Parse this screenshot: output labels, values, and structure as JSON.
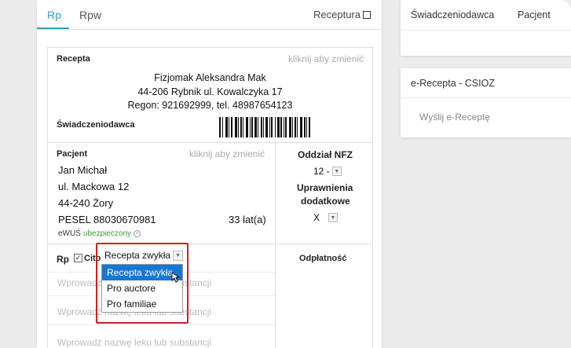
{
  "tabs": {
    "rp": "Rp",
    "rpw": "Rpw",
    "receptura": "Receptura"
  },
  "recepta": {
    "section_label": "Recepta",
    "change_hint": "kliknij aby zmienić",
    "provider_name": "Fizjomak Aleksandra Mak",
    "provider_address": "44-206 Rybnik ul. Kowalczyka 17",
    "provider_regon": "Regon: 921692999, tel. 48987654123",
    "provider_label": "Świadczeniodawca"
  },
  "patient": {
    "section_label": "Pacjent",
    "change_hint": "kliknij aby zmienić",
    "name": "Jan Michał",
    "street": "ul. Mackowa 12",
    "city": "44-240 Żory",
    "pesel": "PESEL  88030670981",
    "age": "33 lat(a)",
    "ewus_label": "eWUŚ",
    "ewus_status": "ubezpieczony"
  },
  "nfz": {
    "label": "Oddział NFZ",
    "value": "12 -",
    "entitlements_label_1": "Uprawnienia",
    "entitlements_label_2": "dodatkowe",
    "entitlements_value": "X"
  },
  "rp_row": {
    "label": "Rp",
    "cito_label": "Cito",
    "select_value": "Recepta zwykła",
    "payment_label": "Odpłatność",
    "placeholder": "Wprowadź nazwę leku lub substancji"
  },
  "dropdown": {
    "options": [
      "Recepta zwykła",
      "Pro auctore",
      "Pro familiae"
    ]
  },
  "right_panel": {
    "tab1": "Świadczeniodawca",
    "tab2": "Pacjent",
    "ecard_title": "e-Recepta - CSIOZ",
    "send_link": "Wyślij e-Receptę"
  },
  "colors": {
    "accent": "#2aa4c4",
    "selected": "#1877d2",
    "highlight": "#d21f1f",
    "insured": "#3a9b3a"
  }
}
